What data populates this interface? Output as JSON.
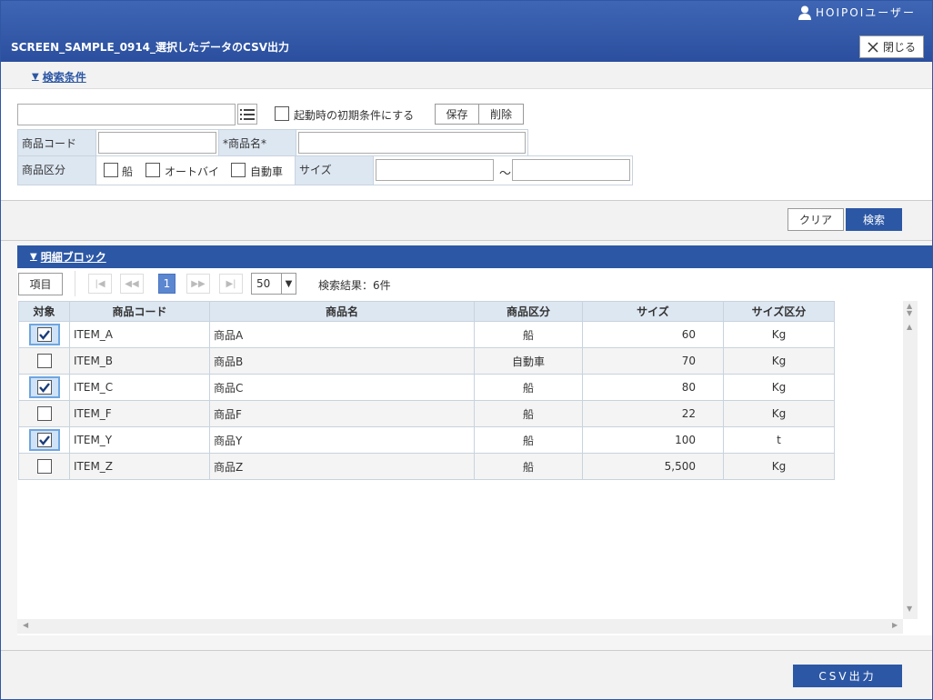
{
  "header": {
    "user_name": "HOIPOIユーザー",
    "title": "SCREEN_SAMPLE_0914_選択したデータのCSV出力",
    "close_label": "閉じる"
  },
  "search": {
    "section_label": "検索条件",
    "preset_checkbox_label": "起動時の初期条件にする",
    "save_label": "保存",
    "delete_label": "削除",
    "product_code_label": "商品コード",
    "product_name_label": "*商品名*",
    "category_label": "商品区分",
    "category_options": [
      "船",
      "オートバイ",
      "自動車"
    ],
    "size_label": "サイズ",
    "range_sep": "～",
    "clear_label": "クリア",
    "search_label": "検索"
  },
  "detail": {
    "section_label": "明細ブロック",
    "columns_button": "項目",
    "current_page": "1",
    "page_size": "50",
    "result_text": "検索結果：6件",
    "columns": [
      "対象",
      "商品コード",
      "商品名",
      "商品区分",
      "サイズ",
      "サイズ区分"
    ],
    "rows": [
      {
        "checked": true,
        "code": "ITEM_A",
        "name": "商品A",
        "category": "船",
        "size": "60",
        "unit": "Kg"
      },
      {
        "checked": false,
        "code": "ITEM_B",
        "name": "商品B",
        "category": "自動車",
        "size": "70",
        "unit": "Kg"
      },
      {
        "checked": true,
        "code": "ITEM_C",
        "name": "商品C",
        "category": "船",
        "size": "80",
        "unit": "Kg"
      },
      {
        "checked": false,
        "code": "ITEM_F",
        "name": "商品F",
        "category": "船",
        "size": "22",
        "unit": "Kg"
      },
      {
        "checked": true,
        "code": "ITEM_Y",
        "name": "商品Y",
        "category": "船",
        "size": "100",
        "unit": "t"
      },
      {
        "checked": false,
        "code": "ITEM_Z",
        "name": "商品Z",
        "category": "船",
        "size": "5,500",
        "unit": "Kg"
      }
    ]
  },
  "footer": {
    "csv_label": "CSV出力"
  }
}
